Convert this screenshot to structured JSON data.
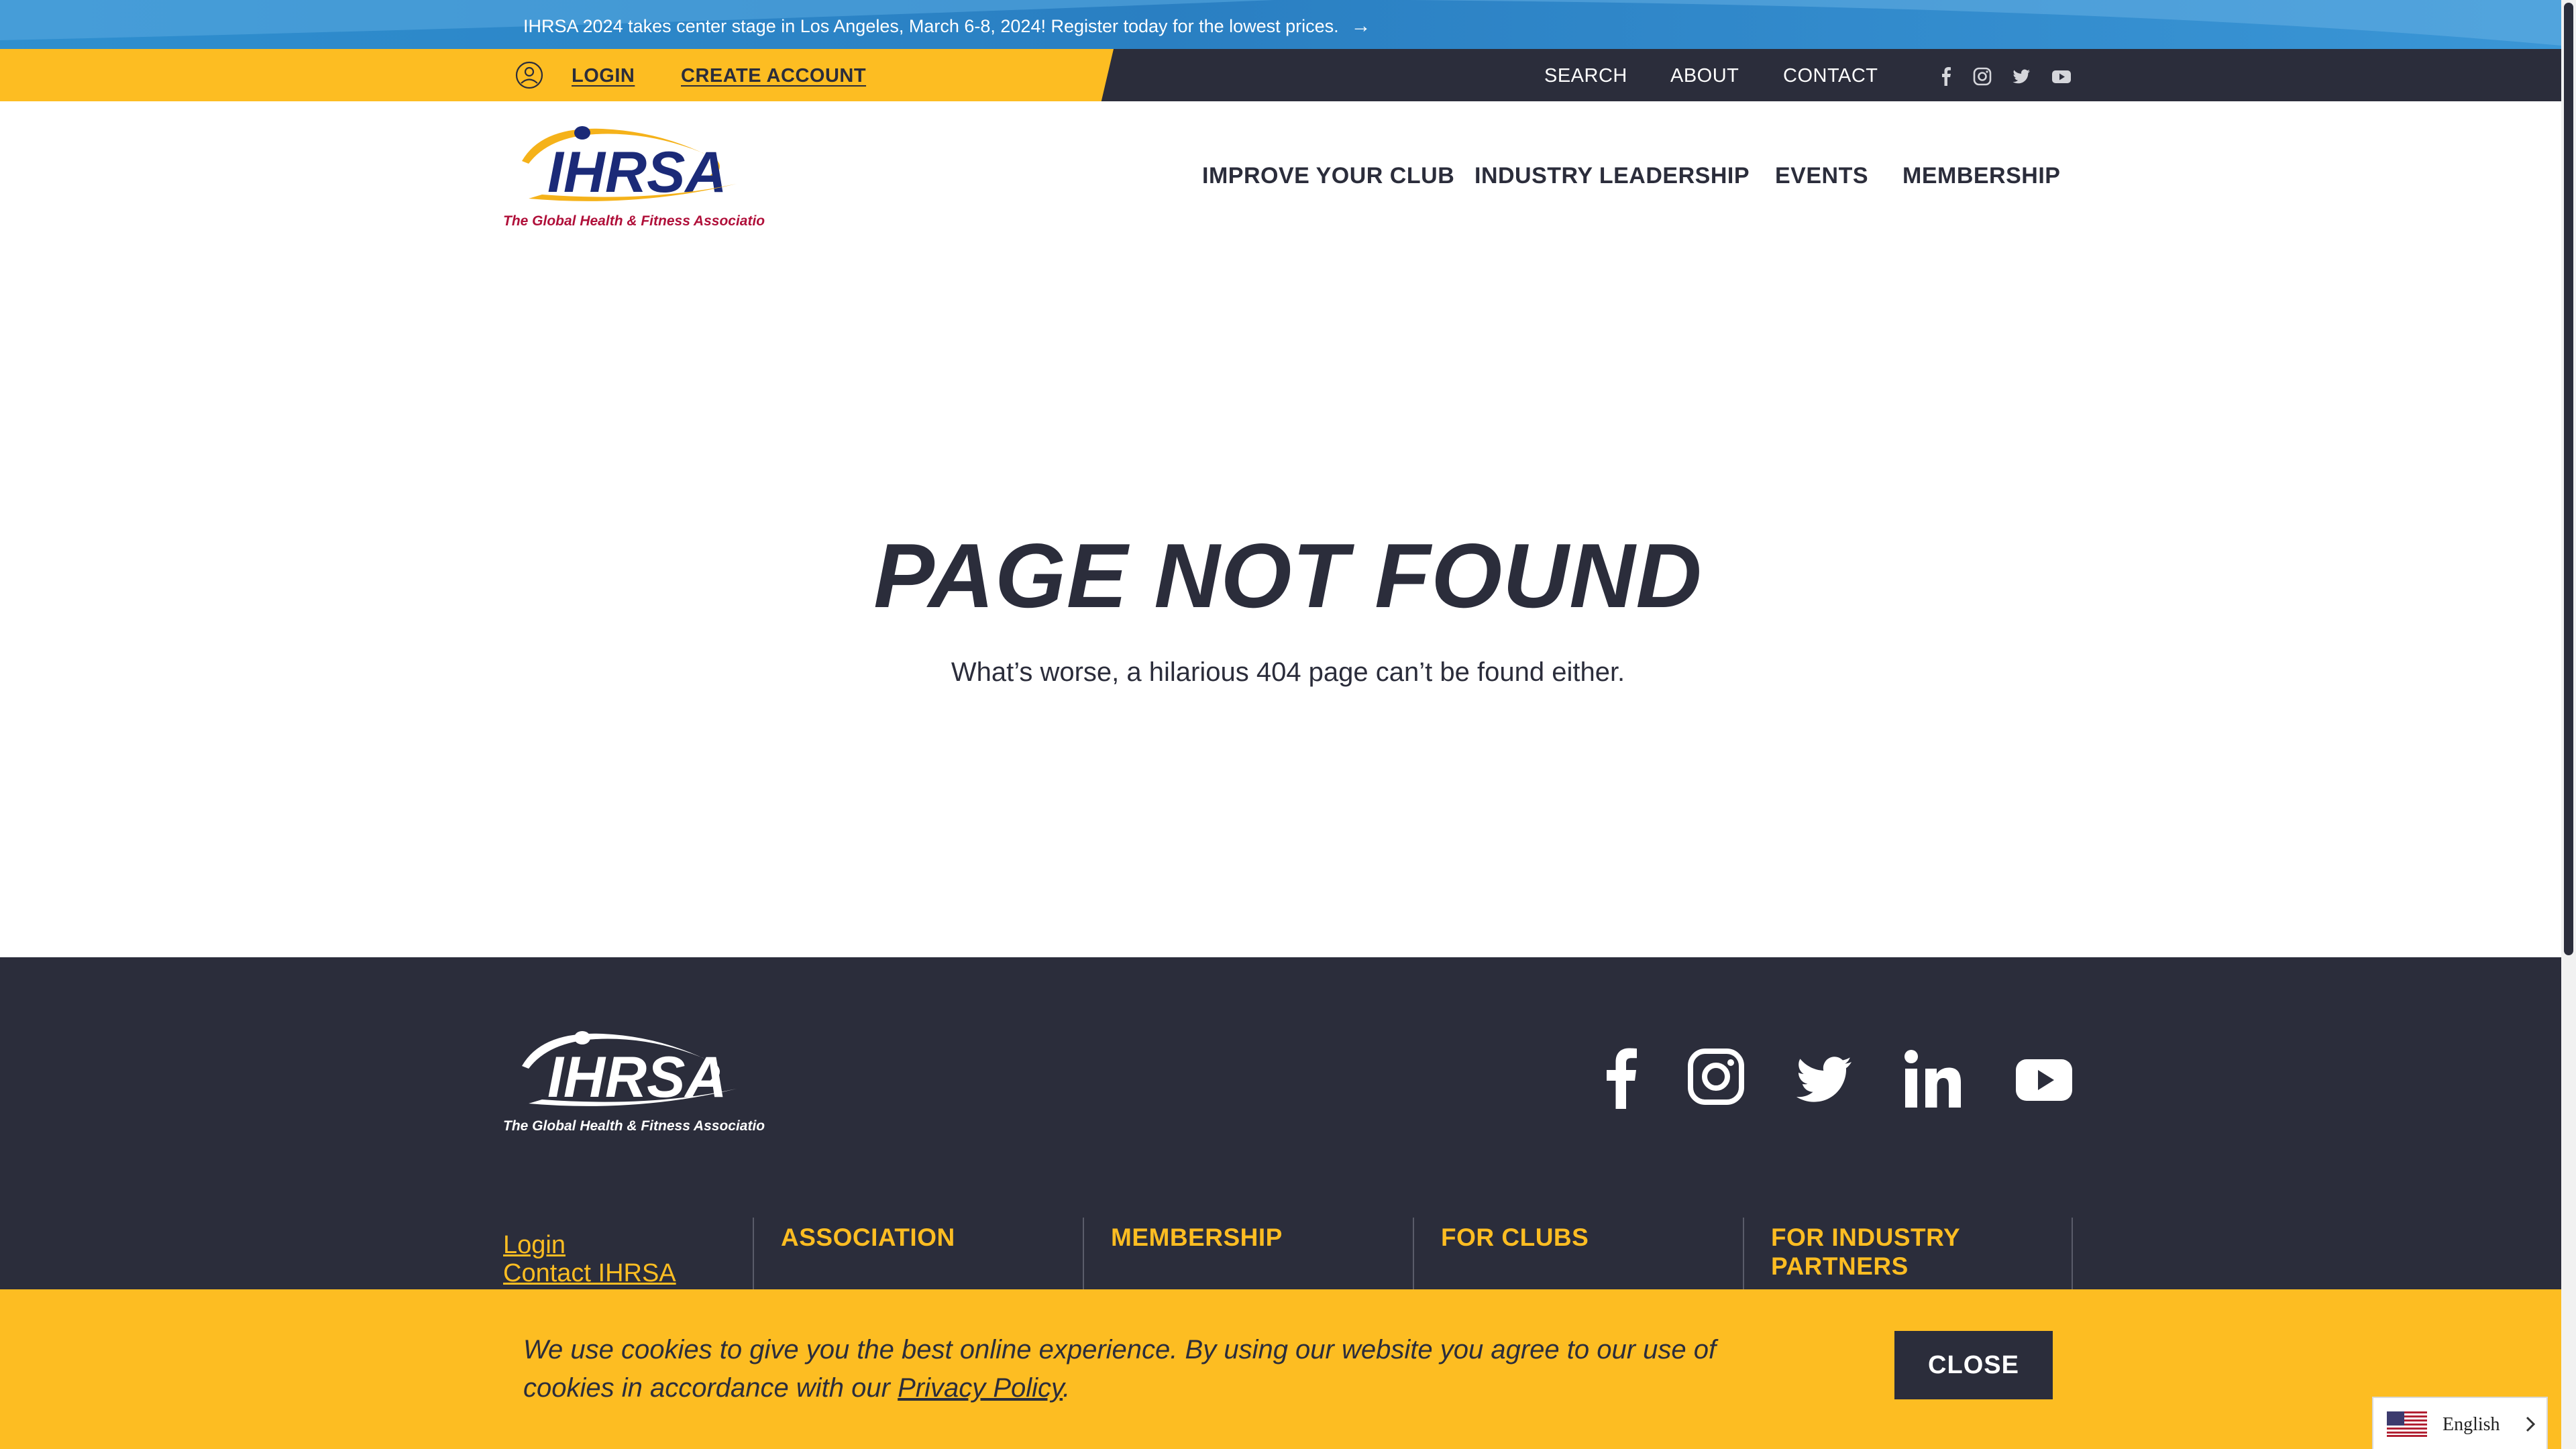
{
  "announcement": {
    "text": "IHRSA 2024 takes center stage in Los Angeles, March 6-8, 2024! Register today for the lowest prices.",
    "arrow": "→"
  },
  "utility_bar": {
    "login": "LOGIN",
    "create_account": "CREATE ACCOUNT",
    "search": "SEARCH",
    "about": "ABOUT",
    "contact": "CONTACT",
    "social_icons": [
      "facebook-icon",
      "instagram-icon",
      "twitter-icon",
      "youtube-icon"
    ]
  },
  "logo": {
    "name": "IHRSA",
    "tagline": "The Global Health & Fitness Association"
  },
  "nav": {
    "items": [
      "IMPROVE YOUR CLUB",
      "INDUSTRY LEADERSHIP",
      "EVENTS",
      "MEMBERSHIP"
    ]
  },
  "main": {
    "title": "PAGE NOT FOUND",
    "subtitle": "What’s worse, a hilarious 404 page can’t be found either."
  },
  "footer": {
    "logo_name": "IHRSA",
    "logo_tagline": "The Global Health & Fitness Association",
    "links": [
      "Login",
      "Contact IHRSA"
    ],
    "columns": [
      "ASSOCIATION",
      "MEMBERSHIP",
      "FOR CLUBS",
      "FOR INDUSTRY PARTNERS"
    ],
    "social_icons": [
      "facebook-icon",
      "instagram-icon",
      "twitter-icon",
      "linkedin-icon",
      "youtube-icon"
    ]
  },
  "cookie": {
    "text_before": "We use cookies to give you the best online experience. By using our website you agree to our use of cookies in accordance with our ",
    "link": "Privacy Policy",
    "text_after": ".",
    "close": "CLOSE"
  },
  "language": {
    "label": "English"
  },
  "colors": {
    "accent_yellow": "#fdbd22",
    "dark_navy": "#2b2d3b",
    "announce_blue": "#2a7fc2",
    "logo_navy": "#1b2a78",
    "logo_red": "#b0103a"
  }
}
